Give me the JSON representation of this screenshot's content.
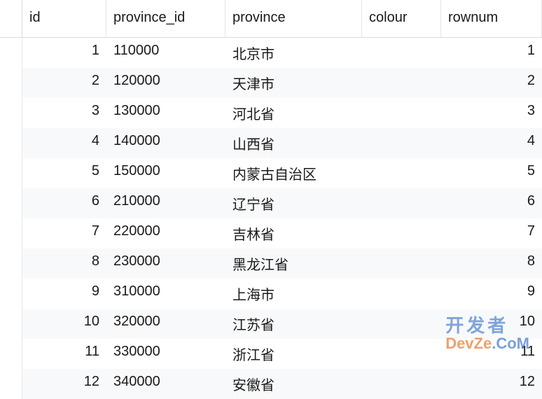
{
  "columns": {
    "id": "id",
    "province_id": "province_id",
    "province": "province",
    "colour": "colour",
    "rownum": "rownum"
  },
  "rows": [
    {
      "id": "1",
      "province_id": "110000",
      "province": "北京市",
      "colour": "",
      "rownum": "1"
    },
    {
      "id": "2",
      "province_id": "120000",
      "province": "天津市",
      "colour": "",
      "rownum": "2"
    },
    {
      "id": "3",
      "province_id": "130000",
      "province": "河北省",
      "colour": "",
      "rownum": "3"
    },
    {
      "id": "4",
      "province_id": "140000",
      "province": "山西省",
      "colour": "",
      "rownum": "4"
    },
    {
      "id": "5",
      "province_id": "150000",
      "province": "内蒙古自治区",
      "colour": "",
      "rownum": "5"
    },
    {
      "id": "6",
      "province_id": "210000",
      "province": "辽宁省",
      "colour": "",
      "rownum": "6"
    },
    {
      "id": "7",
      "province_id": "220000",
      "province": "吉林省",
      "colour": "",
      "rownum": "7"
    },
    {
      "id": "8",
      "province_id": "230000",
      "province": "黑龙江省",
      "colour": "",
      "rownum": "8"
    },
    {
      "id": "9",
      "province_id": "310000",
      "province": "上海市",
      "colour": "",
      "rownum": "9"
    },
    {
      "id": "10",
      "province_id": "320000",
      "province": "江苏省",
      "colour": "",
      "rownum": "10"
    },
    {
      "id": "11",
      "province_id": "330000",
      "province": "浙江省",
      "colour": "",
      "rownum": "11"
    },
    {
      "id": "12",
      "province_id": "340000",
      "province": "安徽省",
      "colour": "",
      "rownum": "12"
    }
  ],
  "watermark": {
    "line1": "开发者",
    "line2a": "DevZe",
    "line2b": ".CoM"
  }
}
